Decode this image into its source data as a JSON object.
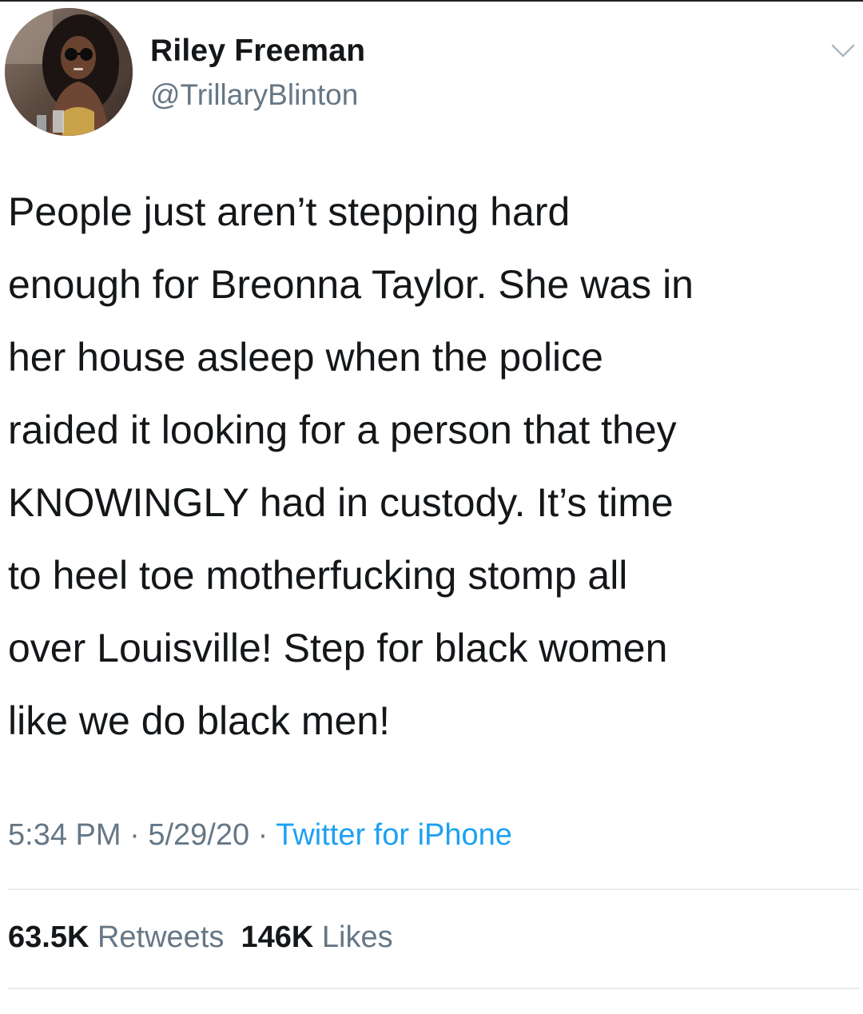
{
  "author": {
    "display_name": "Riley Freeman",
    "handle": "@TrillaryBlinton"
  },
  "tweet": {
    "lines": [
      "People just aren’t stepping hard",
      "enough for Breonna Taylor. She was in",
      "her house asleep when the police",
      "raided it looking for a person that they",
      "KNOWINGLY had in custody. It’s time",
      "to heel toe motherfucking stomp all",
      "over Louisville! Step for black women",
      "like we do black men!"
    ]
  },
  "meta": {
    "time": "5:34 PM",
    "sep1": " · ",
    "date": "5/29/20",
    "sep2": " · ",
    "source": "Twitter for iPhone"
  },
  "stats": {
    "retweets_count": "63.5K",
    "retweets_label": "Retweets",
    "likes_count": "146K",
    "likes_label": "Likes"
  },
  "icons": {
    "menu": "chevron-down-icon"
  },
  "colors": {
    "text": "#14171a",
    "secondary": "#657786",
    "link": "#1da1f2",
    "divider": "#e6ecf0"
  }
}
